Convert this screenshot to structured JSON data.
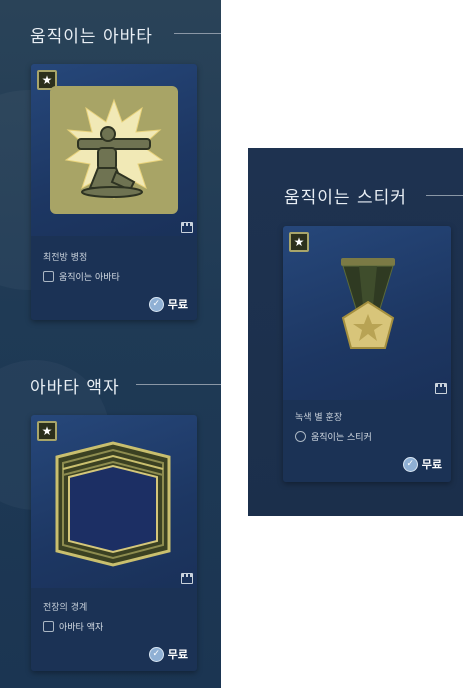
{
  "sections": {
    "animated_avatar": {
      "title": "움직이는 아바타",
      "item": {
        "name": "최전방 병정",
        "type_label": "움직이는 아바타",
        "price": "무료",
        "art_icon": "soldier-bazooka-icon"
      }
    },
    "avatar_frame": {
      "title": "아바타 액자",
      "item": {
        "name": "전장의 경계",
        "type_label": "아바타 액자",
        "price": "무료",
        "art_icon": "military-frame-icon"
      }
    },
    "animated_sticker": {
      "title": "움직이는 스티커",
      "item": {
        "name": "녹색 별 훈장",
        "type_label": "움직이는 스티커",
        "price": "무료",
        "art_icon": "star-medal-icon"
      }
    }
  },
  "icons": {
    "rarity": "star-badge-icon",
    "animated": "film-icon",
    "price": "check-circle-icon"
  },
  "colors": {
    "panel_bg": "#1f3a55",
    "card_bg": "#1b3255",
    "gold": "#b8b46a",
    "text_light": "#e8eef4"
  }
}
